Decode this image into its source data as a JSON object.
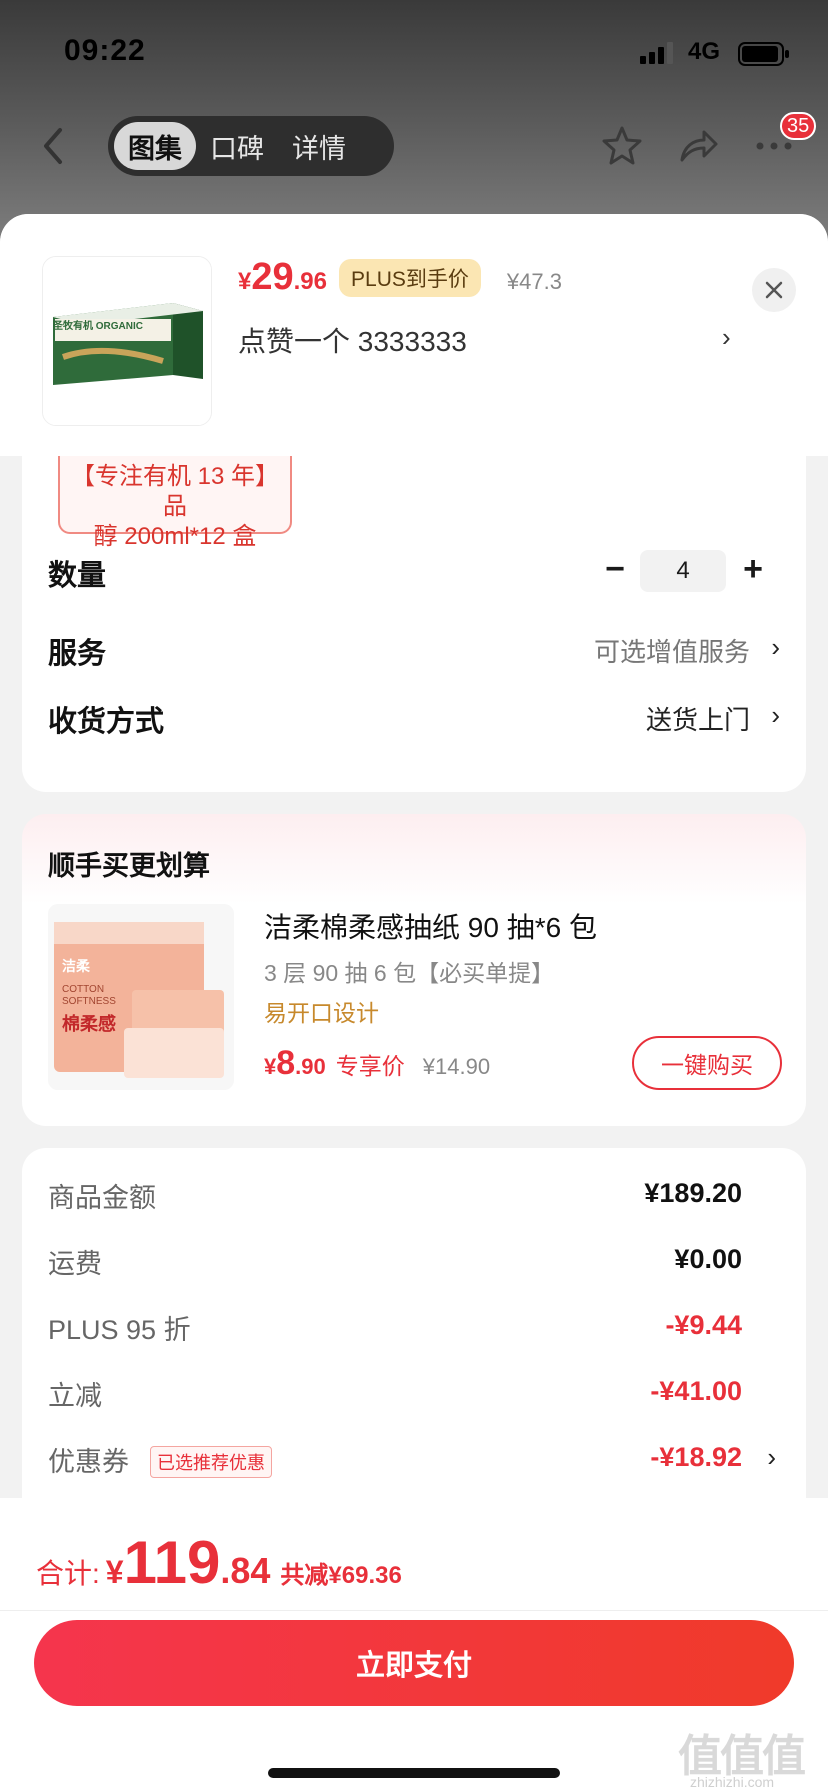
{
  "status_bar": {
    "time": "09:22",
    "network": "4G"
  },
  "nav": {
    "tabs": [
      {
        "label": "图集",
        "active": true
      },
      {
        "label": "口碑",
        "active": false
      },
      {
        "label": "详情",
        "active": false
      }
    ],
    "more_badge": "35"
  },
  "product_header": {
    "price_symbol": "¥",
    "price_int": "29",
    "price_dec": ".96",
    "plus_tag": "PLUS到手价",
    "original_price": "¥47.3",
    "like_text": "点赞一个  3333333",
    "thumb_text": "圣牧有机 ORGANIC"
  },
  "product_options": {
    "highlight_tag_line1": "【专注有机 13 年】品",
    "highlight_tag_line2": "醇 200ml*12 盒",
    "quantity_label": "数量",
    "quantity_value": "4",
    "service_label": "服务",
    "service_value": "可选增值服务",
    "delivery_label": "收货方式",
    "delivery_value": "送货上门"
  },
  "upsell": {
    "title": "顺手买更划算",
    "product_name": "洁柔棉柔感抽纸 90 抽*6 包",
    "spec": "3 层 90 抽 6 包【必买单提】",
    "feature": "易开口设计",
    "price_symbol": "¥",
    "price_int": "8",
    "price_dec": ".90",
    "price_tag": "专享价",
    "original_price": "¥14.90",
    "buy_button": "一键购买",
    "img_brand": "洁柔",
    "img_en1": "COTTON",
    "img_en2": "SOFTNESS",
    "img_cn": "棉柔感"
  },
  "fees": {
    "goods_label": "商品金额",
    "goods_value": "¥189.20",
    "shipping_label": "运费",
    "shipping_value": "¥0.00",
    "plus_label": "PLUS 95 折",
    "plus_value": "-¥9.44",
    "instant_label": "立减",
    "instant_value": "-¥41.00",
    "coupon_label": "优惠券",
    "coupon_tag": "已选推荐优惠",
    "coupon_value": "-¥18.92"
  },
  "footer": {
    "total_label": "合计:",
    "total_symbol": "¥",
    "total_int": "119",
    "total_dec": ".84",
    "saved_text": "共减¥69.36",
    "pay_button": "立即支付"
  },
  "watermark": {
    "main": "值值值",
    "sub": "zhizhizhi.com"
  },
  "colors": {
    "accent_red": "#e8303a",
    "plus_gold": "#fbe6b3",
    "feature_gold": "#c7892c"
  }
}
